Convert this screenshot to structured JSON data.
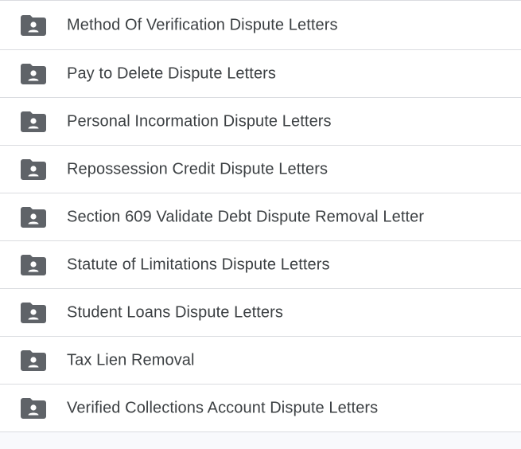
{
  "folders": [
    {
      "label": "Method Of Verification Dispute Letters",
      "icon": "shared-folder-icon"
    },
    {
      "label": "Pay to Delete Dispute Letters",
      "icon": "shared-folder-icon"
    },
    {
      "label": "Personal Incormation Dispute Letters",
      "icon": "shared-folder-icon"
    },
    {
      "label": "Repossession Credit Dispute Letters",
      "icon": "shared-folder-icon"
    },
    {
      "label": "Section 609 Validate Debt Dispute Removal Letter",
      "icon": "shared-folder-icon"
    },
    {
      "label": "Statute of Limitations Dispute Letters",
      "icon": "shared-folder-icon"
    },
    {
      "label": "Student Loans Dispute Letters",
      "icon": "shared-folder-icon"
    },
    {
      "label": "Tax Lien Removal",
      "icon": "shared-folder-icon"
    },
    {
      "label": "Verified Collections Account Dispute Letters",
      "icon": "shared-folder-icon"
    }
  ],
  "colors": {
    "icon": "#5f6368",
    "text": "#3c4043",
    "divider": "#dadce0",
    "background": "#f8f9fc"
  }
}
